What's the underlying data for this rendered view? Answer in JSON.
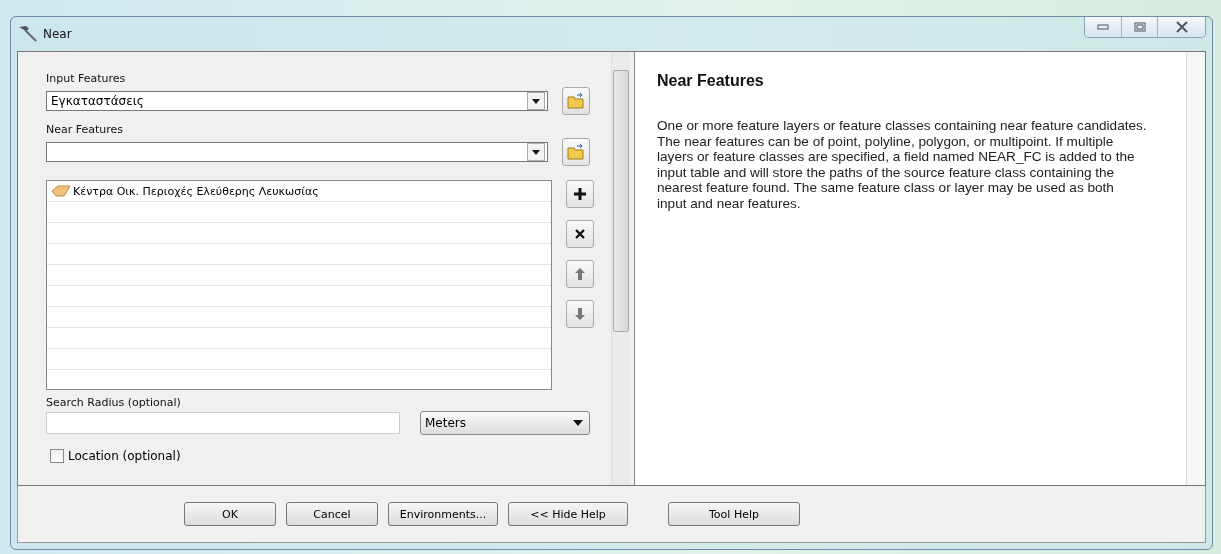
{
  "window": {
    "title": "Near"
  },
  "form": {
    "input_features": {
      "label": "Input Features",
      "value": "Εγκαταστάσεις"
    },
    "near_features": {
      "label": "Near Features"
    },
    "near_list": [
      {
        "label": "Κέντρα Οικ. Περιοχές Ελεύθερης Λευκωσίας"
      }
    ],
    "search_radius": {
      "label": "Search Radius (optional)",
      "unit": "Meters"
    },
    "location": {
      "label": "Location (optional)",
      "checked": false
    }
  },
  "help": {
    "title": "Near Features",
    "text": "One or more feature layers or feature classes containing near feature candidates. The near features can be of point, polyline, polygon, or multipoint. If multiple layers or feature classes are specified, a field named NEAR_FC is added to the input table and will store the paths of the source feature class containing the nearest feature found. The same feature class or layer may be used as both input and near features."
  },
  "buttons": [
    {
      "label": "OK"
    },
    {
      "label": "Cancel"
    },
    {
      "label": "Environments..."
    },
    {
      "label": "<< Hide Help"
    },
    {
      "label": "Tool Help"
    }
  ]
}
